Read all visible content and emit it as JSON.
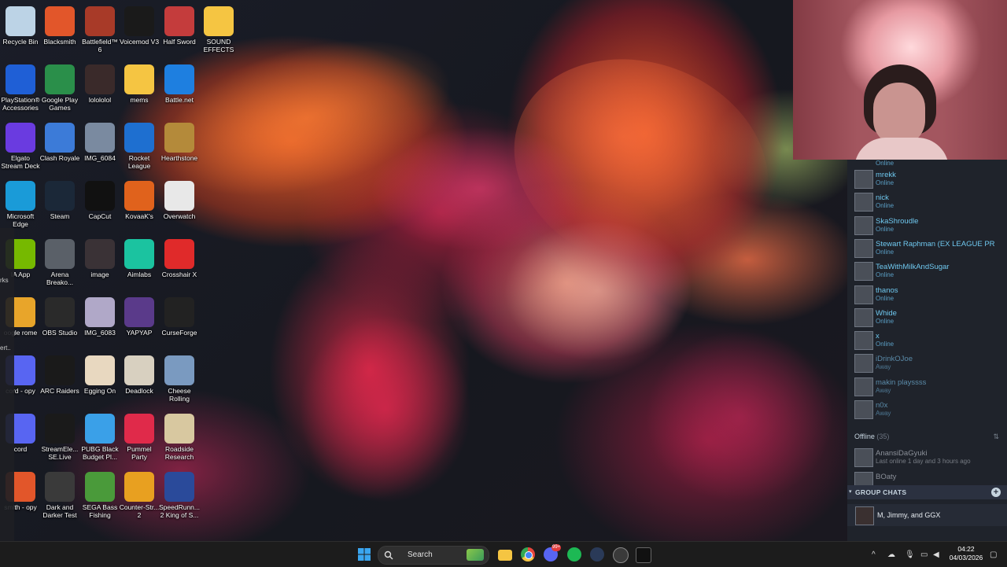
{
  "desktop_icons": [
    {
      "label": "Recycle Bin",
      "icon": "recycle-bin-icon",
      "color": "#bcd3e6"
    },
    {
      "label": "Blacksmith",
      "icon": "blacksmith-icon",
      "color": "#e2562a"
    },
    {
      "label": "Battlefield™ 6",
      "icon": "battlefield-icon",
      "color": "#a83a28"
    },
    {
      "label": "Voicemod V3",
      "icon": "voicemod-icon",
      "color": "#1a1a1a"
    },
    {
      "label": "Half Sword",
      "icon": "half-sword-icon",
      "color": "#c43c3c"
    },
    {
      "label": "SOUND EFFECTS",
      "icon": "folder-icon",
      "color": "#f5c542"
    },
    {
      "label": "PlayStation® Accessories",
      "icon": "playstation-icon",
      "color": "#1f5fd6"
    },
    {
      "label": "Google Play Games",
      "icon": "google-play-games-icon",
      "color": "#2a8f4a"
    },
    {
      "label": "lolololol",
      "icon": "image-thumb-icon",
      "color": "#3a2a2a"
    },
    {
      "label": "mems",
      "icon": "folder-icon",
      "color": "#f5c542"
    },
    {
      "label": "Battle.net",
      "icon": "battlenet-icon",
      "color": "#1e7fe0"
    },
    {
      "label": "Elgato Stream Deck",
      "icon": "stream-deck-icon",
      "color": "#6a3be0"
    },
    {
      "label": "Clash Royale",
      "icon": "clash-royale-icon",
      "color": "#3c7bd8"
    },
    {
      "label": "IMG_6084",
      "icon": "photo-icon",
      "color": "#7a8aa0"
    },
    {
      "label": "Rocket League",
      "icon": "rocket-league-icon",
      "color": "#1e6fd0"
    },
    {
      "label": "Hearthstone",
      "icon": "hearthstone-icon",
      "color": "#b48a3a"
    },
    {
      "label": "Microsoft Edge",
      "icon": "edge-icon",
      "color": "#1a9bd8"
    },
    {
      "label": "Steam",
      "icon": "steam-icon",
      "color": "#1b2838"
    },
    {
      "label": "CapCut",
      "icon": "capcut-icon",
      "color": "#111111"
    },
    {
      "label": "KovaaK's",
      "icon": "kovaaks-icon",
      "color": "#e0621c"
    },
    {
      "label": "Overwatch",
      "icon": "overwatch-icon",
      "color": "#e8e8e8"
    },
    {
      "label": "IA App",
      "icon": "nvidia-icon",
      "color": "#76b900"
    },
    {
      "label": "Arena Breako...",
      "icon": "arena-breakout-icon",
      "color": "#5a6068"
    },
    {
      "label": "image",
      "icon": "photo-icon",
      "color": "#3a3236"
    },
    {
      "label": "Aimlabs",
      "icon": "aimlabs-icon",
      "color": "#1bc3a0"
    },
    {
      "label": "Crosshair X",
      "icon": "crosshair-x-icon",
      "color": "#e02a2a"
    },
    {
      "label": "oogle rome",
      "icon": "chrome-icon",
      "color": "#e8a52a"
    },
    {
      "label": "OBS Studio",
      "icon": "obs-icon",
      "color": "#2a2a2a"
    },
    {
      "label": "IMG_6083",
      "icon": "photo-icon",
      "color": "#b0a8c8"
    },
    {
      "label": "YAPYAP",
      "icon": "yapyap-icon",
      "color": "#5a3a8a"
    },
    {
      "label": "CurseForge",
      "icon": "curseforge-icon",
      "color": "#222222"
    },
    {
      "label": "cord - opy",
      "icon": "discord-icon",
      "color": "#5865f2"
    },
    {
      "label": "ARC Raiders",
      "icon": "arc-raiders-icon",
      "color": "#1a1a1a"
    },
    {
      "label": "Egging On",
      "icon": "egg-icon",
      "color": "#e8d8c0"
    },
    {
      "label": "Deadlock",
      "icon": "deadlock-icon",
      "color": "#d8d0c0"
    },
    {
      "label": "Cheese Rolling",
      "icon": "cheese-rolling-icon",
      "color": "#7a9ac0"
    },
    {
      "label": "cord",
      "icon": "discord-icon",
      "color": "#5865f2"
    },
    {
      "label": "StreamEle... SE.Live",
      "icon": "streamelements-icon",
      "color": "#1a1a1a"
    },
    {
      "label": "PUBG Black Budget Pl...",
      "icon": "pubg-icon",
      "color": "#3aa0e8"
    },
    {
      "label": "Pummel Party",
      "icon": "pummel-party-icon",
      "color": "#e02a4a"
    },
    {
      "label": "Roadside Research",
      "icon": "roadside-research-icon",
      "color": "#d8c8a0"
    },
    {
      "label": "smith - opy",
      "icon": "blacksmith-icon",
      "color": "#e2562a"
    },
    {
      "label": "Dark and Darker Test",
      "icon": "dark-and-darker-icon",
      "color": "#3a3a3a"
    },
    {
      "label": "SEGA Bass Fishing",
      "icon": "sega-bass-fishing-icon",
      "color": "#4a9a3a"
    },
    {
      "label": "Counter-Str... 2",
      "icon": "counter-strike-icon",
      "color": "#e8a020"
    },
    {
      "label": "SpeedRunn... 2 King of S...",
      "icon": "speedrunners-icon",
      "color": "#2a4a9a"
    }
  ],
  "left_strip": [
    "rks",
    "ert.."
  ],
  "friends": {
    "top_status": "Online",
    "list": [
      {
        "name": "mrekk",
        "status": "Online",
        "state": "online"
      },
      {
        "name": "nick",
        "status": "Online",
        "state": "online"
      },
      {
        "name": "SkaShroudle",
        "status": "Online",
        "state": "online"
      },
      {
        "name": "Stewart Raphman (EX LEAGUE PR",
        "status": "Online",
        "state": "online"
      },
      {
        "name": "TeaWithMilkAndSugar",
        "status": "Online",
        "state": "online"
      },
      {
        "name": "thanos",
        "status": "Online",
        "state": "online"
      },
      {
        "name": "Whide",
        "status": "Online",
        "state": "online"
      },
      {
        "name": "x",
        "status": "Online",
        "state": "online"
      },
      {
        "name": "iDrinkOJoe",
        "status": "Away",
        "state": "away"
      },
      {
        "name": "makin playssss",
        "status": "Away",
        "state": "away"
      },
      {
        "name": "n0x",
        "status": "Away",
        "state": "away"
      }
    ],
    "offline_label": "Offline",
    "offline_count": "(35)",
    "offline_list": [
      {
        "name": "AnansiDaGyuki",
        "status": "Last online 1 day and 3 hours ago"
      },
      {
        "name": "BOaty",
        "status": ""
      }
    ],
    "group_chats_label": "GROUP CHATS",
    "group_chats": [
      {
        "name": "M, Jimmy, and GGX"
      }
    ]
  },
  "taskbar": {
    "search_placeholder": "Search",
    "time": "04:22",
    "date": "04/03/2026",
    "badge_count": "99+"
  },
  "colors": {
    "steam_bg": "#1f232b",
    "online_blue": "#6fc8ef",
    "taskbar_bg": "#1c1c1c"
  }
}
